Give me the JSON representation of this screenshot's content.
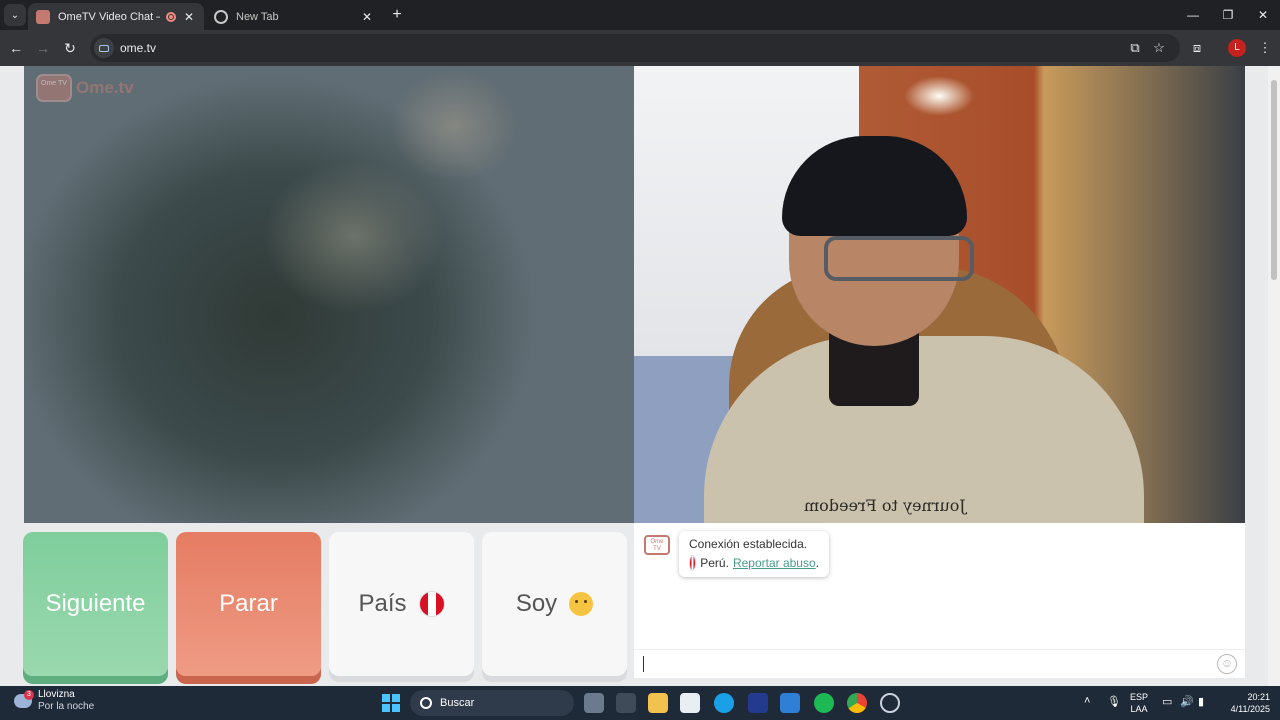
{
  "browser": {
    "tabs": [
      {
        "title": "OmeTV Video Chat — Ome",
        "active": true
      },
      {
        "title": "New Tab",
        "active": false
      }
    ],
    "url": "ome.tv",
    "profile_initial": "L"
  },
  "site": {
    "logo_badge": "Ome TV",
    "logo_text": "Ome.tv"
  },
  "video": {
    "shirt_text": "Journey to Freedom"
  },
  "controls": {
    "next_label": "Siguiente",
    "stop_label": "Parar",
    "country_label": "País",
    "gender_label": "Soy"
  },
  "chat": {
    "logo_badge": "Ome TV",
    "status": "Conexión establecida.",
    "country": "Perú.",
    "report_link": "Reportar abuso",
    "report_suffix": ".",
    "input_value": ""
  },
  "taskbar": {
    "weather_title": "Llovizna",
    "weather_sub": "Por la noche",
    "weather_badge": "3",
    "search_placeholder": "Buscar",
    "lang_1": "ESP",
    "lang_2": "LAA",
    "time": "20:21",
    "date": "4/11/2025"
  },
  "colors": {
    "next": "#7fce9c",
    "stop": "#e57c63",
    "accent_link": "#4a9a8a",
    "brand": "#c47a70"
  }
}
